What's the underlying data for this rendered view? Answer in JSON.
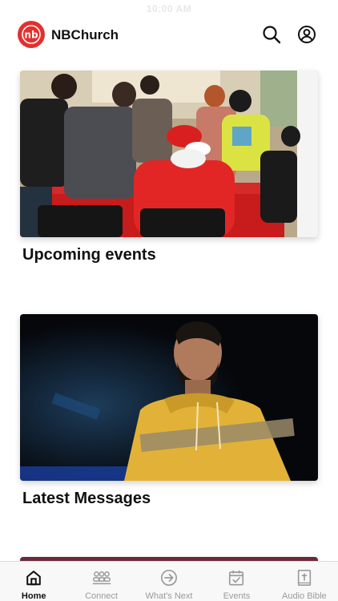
{
  "status_bar": {
    "time": "10:00 AM"
  },
  "header": {
    "app_name": "NBChurch",
    "logo_initials": "nb"
  },
  "cards": [
    {
      "title": "Upcoming events"
    },
    {
      "title": "Latest Messages"
    }
  ],
  "tabbar": {
    "tabs": [
      {
        "label": "Home",
        "icon": "home-icon",
        "active": true
      },
      {
        "label": "Connect",
        "icon": "people-icon",
        "active": false
      },
      {
        "label": "What's Next",
        "icon": "arrow-circle-icon",
        "active": false
      },
      {
        "label": "Events",
        "icon": "calendar-check-icon",
        "active": false
      },
      {
        "label": "Audio Bible",
        "icon": "bible-icon",
        "active": false
      }
    ]
  },
  "colors": {
    "brand": "#e3302f",
    "active_tab": "#111111",
    "inactive_tab": "#9a9a9a"
  }
}
